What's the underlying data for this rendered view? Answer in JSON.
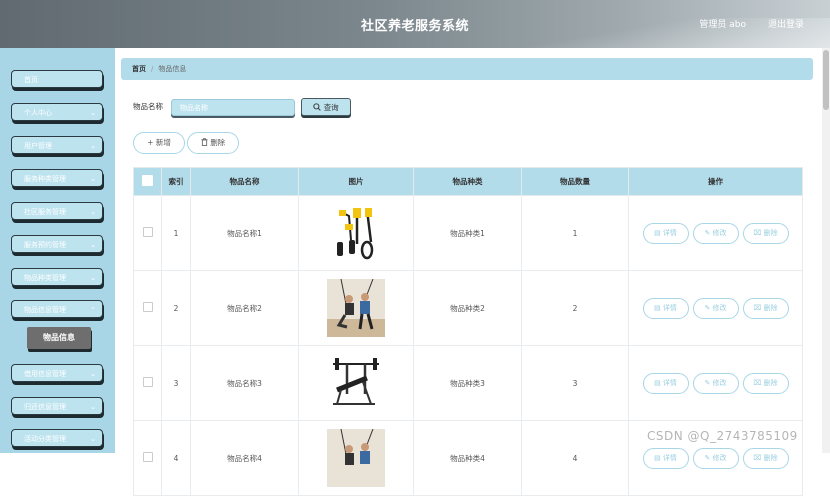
{
  "header": {
    "title": "社区养老服务系统",
    "user": "管理员 abo",
    "logout": "退出登录"
  },
  "sidebar": {
    "items": [
      {
        "label": "首页"
      },
      {
        "label": "个人中心"
      },
      {
        "label": "用户管理"
      },
      {
        "label": "服务种类管理"
      },
      {
        "label": "社区服务管理"
      },
      {
        "label": "服务预约管理"
      },
      {
        "label": "物品种类管理"
      },
      {
        "label": "物品信息管理"
      },
      {
        "label": "借用信息管理"
      },
      {
        "label": "归还信息管理"
      },
      {
        "label": "活动分类管理"
      }
    ],
    "active_sub": "物品信息"
  },
  "breadcrumb": {
    "home": "首页",
    "separator": "/",
    "current": "物品信息"
  },
  "search": {
    "label": "物品名称",
    "placeholder": "物品名称",
    "button": "查询"
  },
  "actions": {
    "add": "新增",
    "delete": "删除"
  },
  "table": {
    "headers": [
      "",
      "索引",
      "物品名称",
      "图片",
      "物品种类",
      "物品数量",
      "操作"
    ],
    "rows": [
      {
        "index": "1",
        "name": "物品名称1",
        "category": "物品种类1",
        "qty": "1"
      },
      {
        "index": "2",
        "name": "物品名称2",
        "category": "物品种类2",
        "qty": "2"
      },
      {
        "index": "3",
        "name": "物品名称3",
        "category": "物品种类3",
        "qty": "3"
      },
      {
        "index": "4",
        "name": "物品名称4",
        "category": "物品种类4",
        "qty": "4"
      }
    ],
    "ops": {
      "detail": "详情",
      "edit": "修改",
      "delete": "删除"
    }
  },
  "watermark": "CSDN @Q_2743785109"
}
